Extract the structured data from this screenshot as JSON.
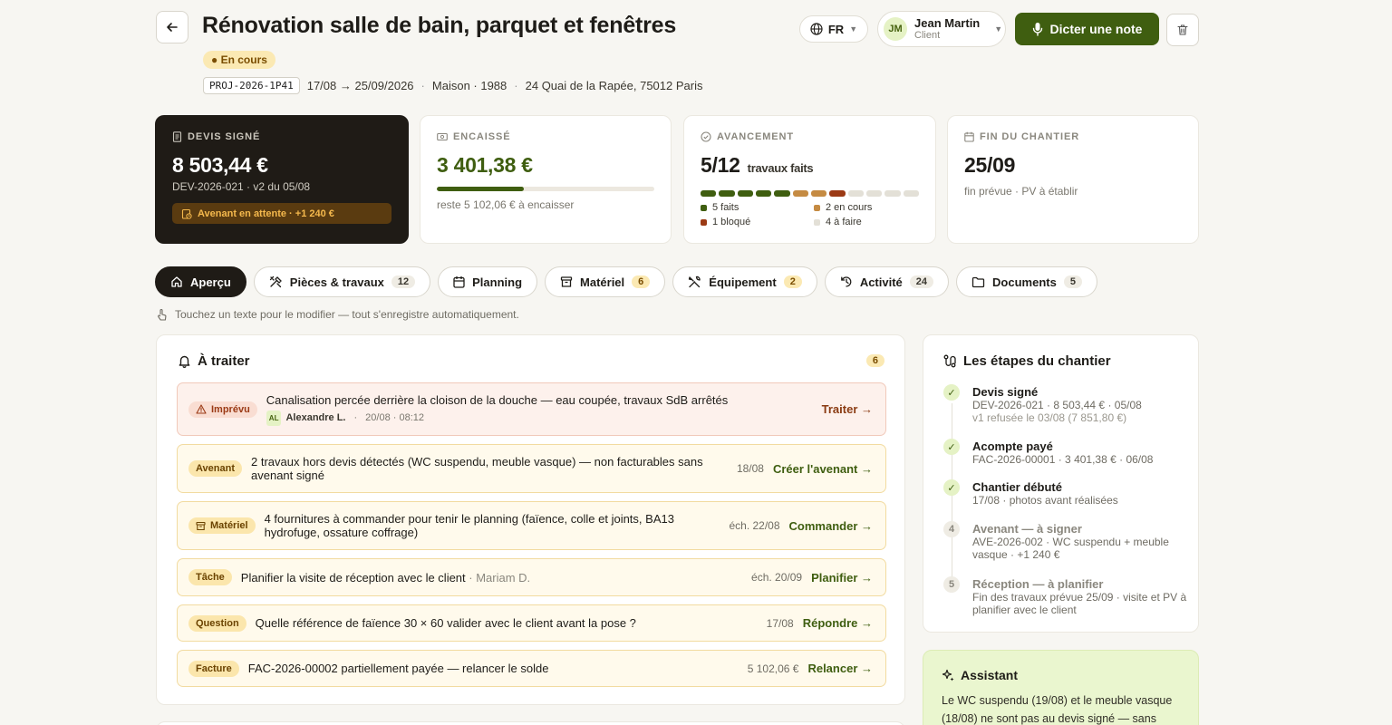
{
  "header": {
    "title": "Rénovation salle de bain, parquet et fenêtres",
    "status": "● En cours",
    "ref": "PROJ-2026-1P41",
    "dates": "17/08 → 25/09/2026",
    "type": "Maison · 1988",
    "address": "24 Quai de la Rapée, 75012 Paris",
    "lang": "FR",
    "user": {
      "initials": "JM",
      "name": "Jean Martin",
      "role": "Client"
    },
    "dictate_label": "Dicter une note"
  },
  "cards": {
    "devis": {
      "label": "DEVIS SIGNÉ",
      "value": "8 503,44 €",
      "sub": "DEV-2026-021 · v2 du 05/08",
      "pending": "Avenant en attente · +1 240 €"
    },
    "encaisse": {
      "label": "ENCAISSÉ",
      "value": "3 401,38 €",
      "progress": 0.4,
      "sub": "reste 5 102,06 € à encaisser"
    },
    "avancement": {
      "label": "AVANCEMENT",
      "value": "5/12",
      "unit": "travaux faits",
      "segments": [
        "done",
        "done",
        "done",
        "done",
        "done",
        "progress",
        "progress",
        "blocked",
        "todo",
        "todo",
        "todo",
        "todo"
      ],
      "legend": [
        {
          "label": "5 faits",
          "color": "#3f5e10"
        },
        {
          "label": "2 en cours",
          "color": "#c58b43"
        },
        {
          "label": "1 bloqué",
          "color": "#9b3a15"
        },
        {
          "label": "4 à faire",
          "color": "#e3e0d7"
        }
      ]
    },
    "fin": {
      "label": "FIN DU CHANTIER",
      "value": "25/09",
      "sub": "fin prévue · PV à établir"
    }
  },
  "colors": {
    "done": "#3f5e10",
    "progress": "#c58b43",
    "blocked": "#9b3a15",
    "todo": "#e3e0d7"
  },
  "tabs": [
    {
      "label": "Aperçu",
      "count": null,
      "icon": "home-icon",
      "active": true
    },
    {
      "label": "Pièces & travaux",
      "count": "12",
      "icon": "tools-icon"
    },
    {
      "label": "Planning",
      "count": null,
      "icon": "calendar-icon"
    },
    {
      "label": "Matériel",
      "count": "6",
      "icon": "box-icon",
      "warn": true
    },
    {
      "label": "Équipement",
      "count": "2",
      "icon": "wrench-icon",
      "warn": true
    },
    {
      "label": "Activité",
      "count": "24",
      "icon": "history-icon"
    },
    {
      "label": "Documents",
      "count": "5",
      "icon": "folder-icon"
    }
  ],
  "hint": "Touchez un texte pour le modifier — tout s'enregistre automatiquement.",
  "todo": {
    "title": "À traiter",
    "count": "6",
    "items": [
      {
        "tag": "Imprévu",
        "text": "Canalisation percée derrière la cloison de la douche — eau coupée, travaux SdB arrêtés",
        "author_initials": "AL",
        "author": "Alexandre L.",
        "time": "20/08 · 08:12",
        "meta": "",
        "action": "Traiter →"
      },
      {
        "tag": "Avenant",
        "text": "2 travaux hors devis détectés (WC suspendu, meuble vasque) — non facturables sans avenant signé",
        "meta": "18/08",
        "action": "Créer l'avenant →"
      },
      {
        "tag": "Matériel",
        "text": "4 fournitures à commander pour tenir le planning (faïence, colle et joints, BA13 hydrofuge, ossature coffrage)",
        "meta": "éch. 22/08",
        "action": "Commander →"
      },
      {
        "tag": "Tâche",
        "text": "Planifier la visite de réception avec le client",
        "text_muted": " · Mariam D.",
        "meta": "éch. 20/09",
        "action": "Planifier →"
      },
      {
        "tag": "Question",
        "text": "Quelle référence de faïence 30 × 60 valider avec le client avant la pose ?",
        "meta": "17/08",
        "action": "Répondre →"
      },
      {
        "tag": "Facture",
        "text": "FAC-2026-00002 partiellement payée — relancer le solde",
        "meta": "5 102,06 €",
        "action": "Relancer →"
      }
    ]
  },
  "steps": {
    "title": "Les étapes du chantier",
    "items": [
      {
        "marker": "✓",
        "title": "Devis signé",
        "sub": "DEV-2026-021 · 8 503,44 € · 05/08",
        "sub2": "v1 refusée le 03/08 (7 851,80 €)",
        "done": true
      },
      {
        "marker": "✓",
        "title": "Acompte payé",
        "sub": "FAC-2026-00001 · 3 401,38 € · 06/08",
        "done": true
      },
      {
        "marker": "✓",
        "title": "Chantier débuté",
        "sub": "17/08 · photos avant réalisées",
        "done": true
      },
      {
        "marker": "4",
        "title": "Avenant — à signer",
        "sub": "AVE-2026-002 · WC suspendu + meuble vasque · +1 240 €",
        "done": false
      },
      {
        "marker": "5",
        "title": "Réception — à planifier",
        "sub": "Fin des travaux prévue 25/09 · visite et PV à planifier avec le client",
        "done": false
      }
    ]
  },
  "assistant": {
    "title": "Assistant",
    "text": "Le WC suspendu (19/08) et le meuble vasque (18/08) ne sont pas au devis signé — sans"
  }
}
